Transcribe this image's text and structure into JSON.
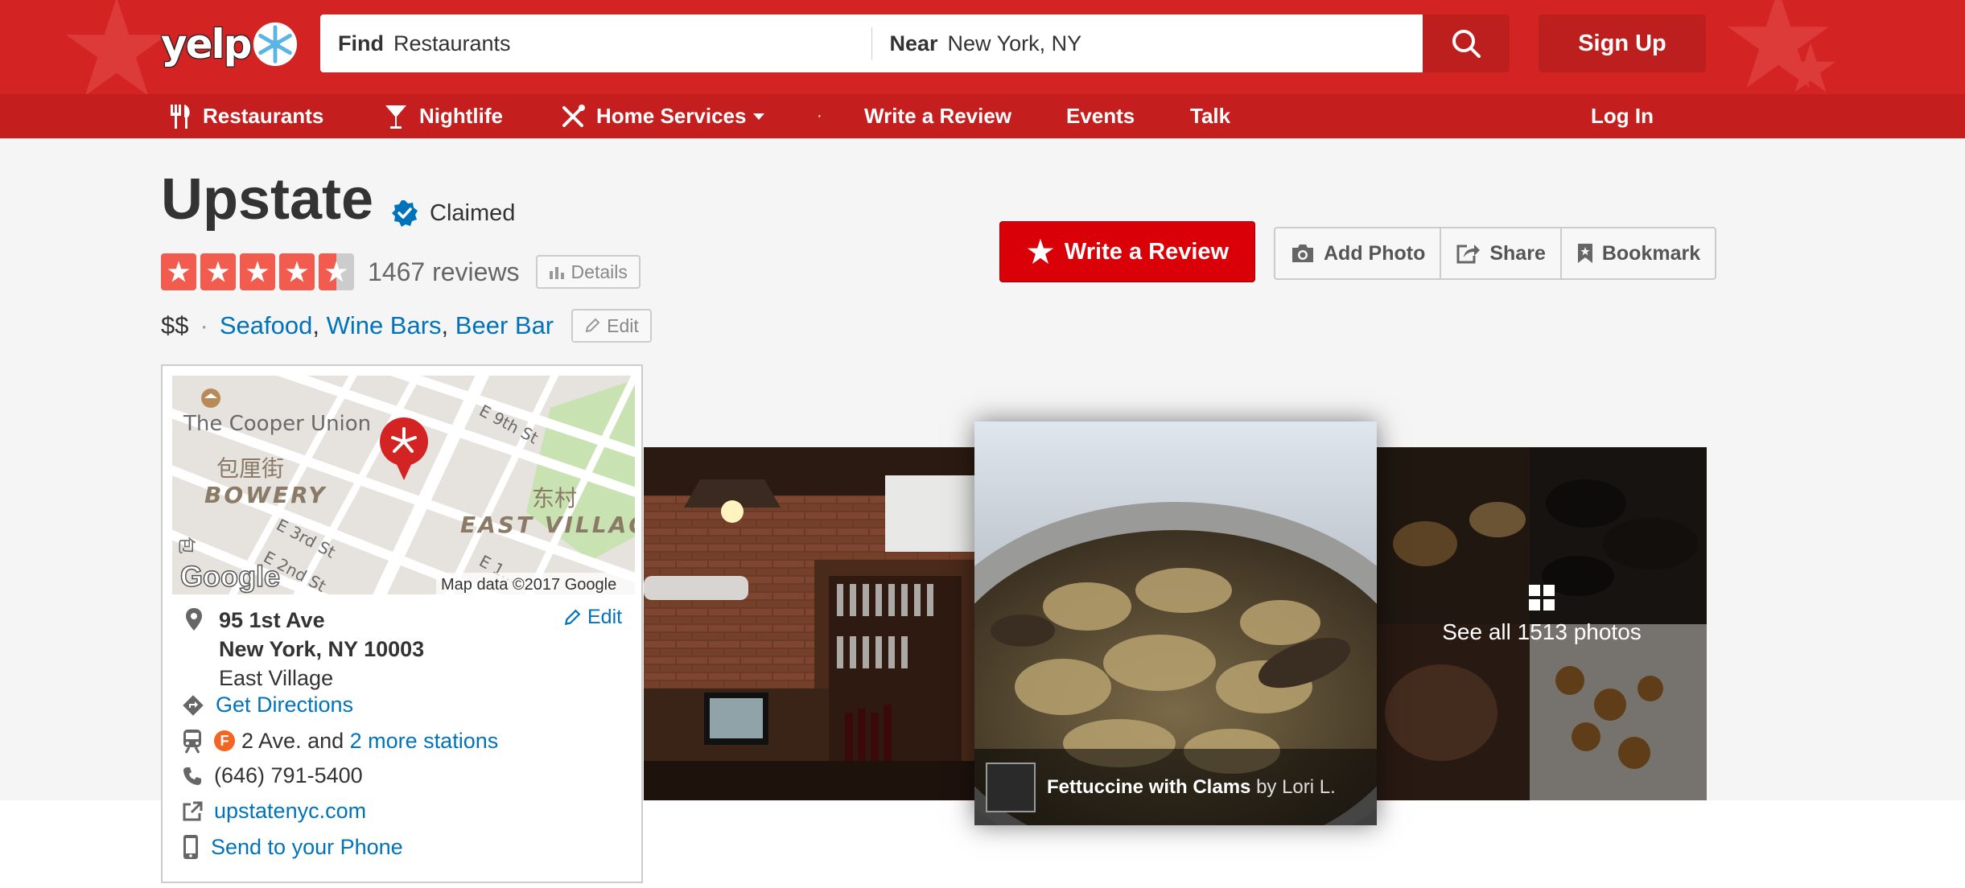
{
  "header": {
    "logo_text": "yelp",
    "search": {
      "find_label": "Find",
      "find_value": "Restaurants",
      "near_label": "Near",
      "near_value": "New York, NY"
    },
    "signup_label": "Sign Up",
    "brand_color": "#d32323"
  },
  "nav": {
    "items": [
      {
        "label": "Restaurants",
        "icon": "fork-knife-icon"
      },
      {
        "label": "Nightlife",
        "icon": "cocktail-icon"
      },
      {
        "label": "Home Services",
        "icon": "tools-icon"
      }
    ],
    "dot": "·",
    "write_review": "Write a Review",
    "events": "Events",
    "talk": "Talk",
    "login": "Log In"
  },
  "business": {
    "name": "Upstate",
    "claimed_label": "Claimed",
    "rating": 4.5,
    "max_rating": 5,
    "review_count": "1467 reviews",
    "details_label": "Details",
    "price": "$$",
    "separator": "·",
    "categories": [
      "Seafood",
      "Wine Bars",
      "Beer Bar"
    ],
    "category_sep": ",",
    "edit_label": "Edit"
  },
  "actions": {
    "write_review": "Write a Review",
    "add_photo": "Add Photo",
    "share": "Share",
    "bookmark": "Bookmark"
  },
  "map": {
    "labels": {
      "cooper_union": "The Cooper Union",
      "e9": "E 9th St",
      "bowery_cn": "包厘街",
      "bowery": "BOWERY",
      "east_village_cn": "东村",
      "east_village": "EAST VILLAG",
      "e3": "E 3rd St",
      "e2": "E 2nd St",
      "e1": "E 1...",
      "side_cn": "包",
      "google": "Google",
      "map_data": "Map data ©2017 Google"
    }
  },
  "location": {
    "address_line1": "95 1st Ave",
    "address_line2": "New York, NY 10003",
    "neighborhood": "East Village",
    "edit_label": "Edit",
    "directions": "Get Directions",
    "subway_line": "F",
    "subway_text": "2 Ave. and",
    "subway_more": "2 more stations",
    "phone": "(646) 791-5400",
    "website": "upstatenyc.com",
    "send_to_phone": "Send to your Phone"
  },
  "photos": {
    "featured_caption_title": "Fettuccine with Clams",
    "featured_caption_by": "by Lori L.",
    "see_all": "See all 1513 photos"
  }
}
